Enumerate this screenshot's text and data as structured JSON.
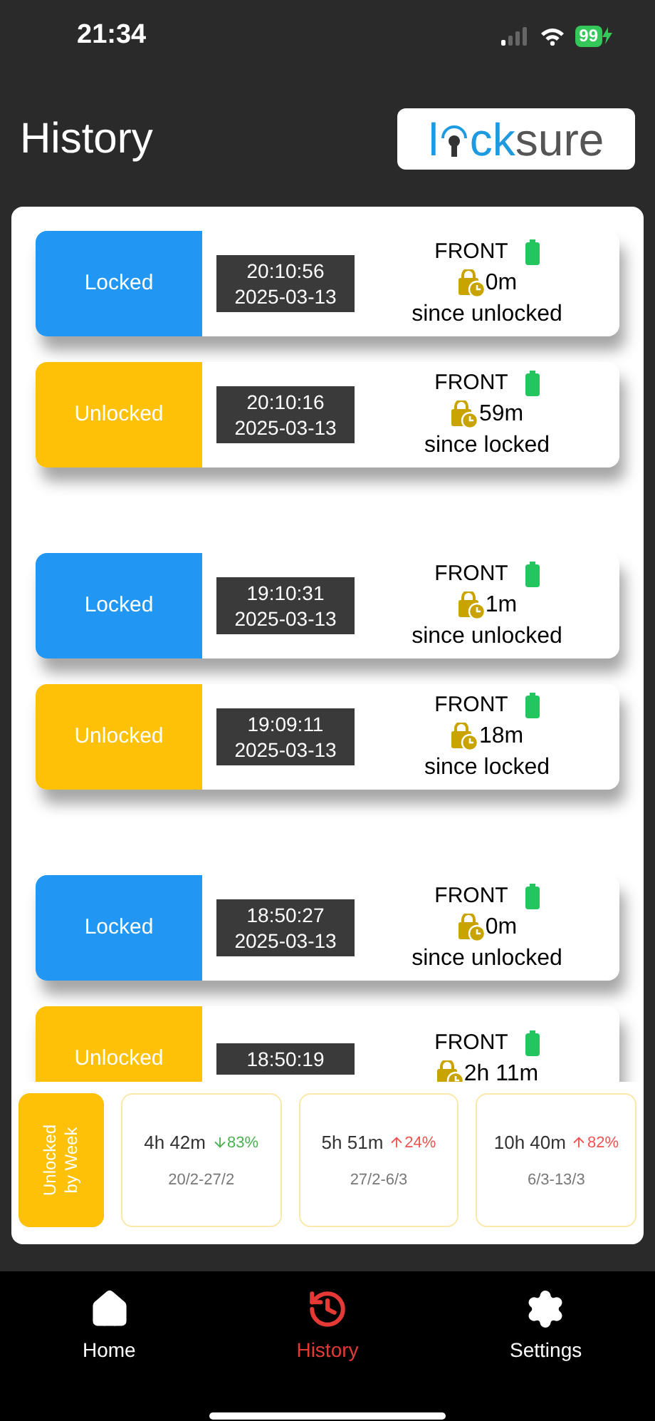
{
  "status_bar": {
    "time": "21:34",
    "battery": "99"
  },
  "header": {
    "title": "History",
    "logo": {
      "prefix": "l",
      "middle": "ck",
      "suffix": "sure"
    }
  },
  "groups": [
    {
      "events": [
        {
          "kind": "locked",
          "label": "Locked",
          "time": "20:10:56",
          "date": "2025-03-13",
          "door": "FRONT",
          "duration": "0m",
          "since": "since unlocked"
        },
        {
          "kind": "unlocked",
          "label": "Unlocked",
          "time": "20:10:16",
          "date": "2025-03-13",
          "door": "FRONT",
          "duration": "59m",
          "since": "since locked"
        }
      ]
    },
    {
      "events": [
        {
          "kind": "locked",
          "label": "Locked",
          "time": "19:10:31",
          "date": "2025-03-13",
          "door": "FRONT",
          "duration": "1m",
          "since": "since unlocked"
        },
        {
          "kind": "unlocked",
          "label": "Unlocked",
          "time": "19:09:11",
          "date": "2025-03-13",
          "door": "FRONT",
          "duration": "18m",
          "since": "since locked"
        }
      ]
    },
    {
      "events": [
        {
          "kind": "locked",
          "label": "Locked",
          "time": "18:50:27",
          "date": "2025-03-13",
          "door": "FRONT",
          "duration": "0m",
          "since": "since unlocked"
        },
        {
          "kind": "unlocked",
          "label": "Unlocked",
          "time": "18:50:19",
          "door": "FRONT",
          "duration": "2h 11m"
        }
      ]
    }
  ],
  "weekly": {
    "title": "Unlocked by Week",
    "weeks": [
      {
        "duration": "4h 42m",
        "kind": "down",
        "change": "83%",
        "range": "20/2-27/2"
      },
      {
        "duration": "5h 51m",
        "kind": "up",
        "change": "24%",
        "range": "27/2-6/3"
      },
      {
        "duration": "10h 40m",
        "kind": "up",
        "change": "82%",
        "range": "6/3-13/3"
      }
    ]
  },
  "nav": [
    {
      "kind": "home",
      "label": "Home",
      "selected": false
    },
    {
      "kind": "history",
      "label": "History",
      "selected": true
    },
    {
      "kind": "settings",
      "label": "Settings",
      "selected": false
    }
  ]
}
